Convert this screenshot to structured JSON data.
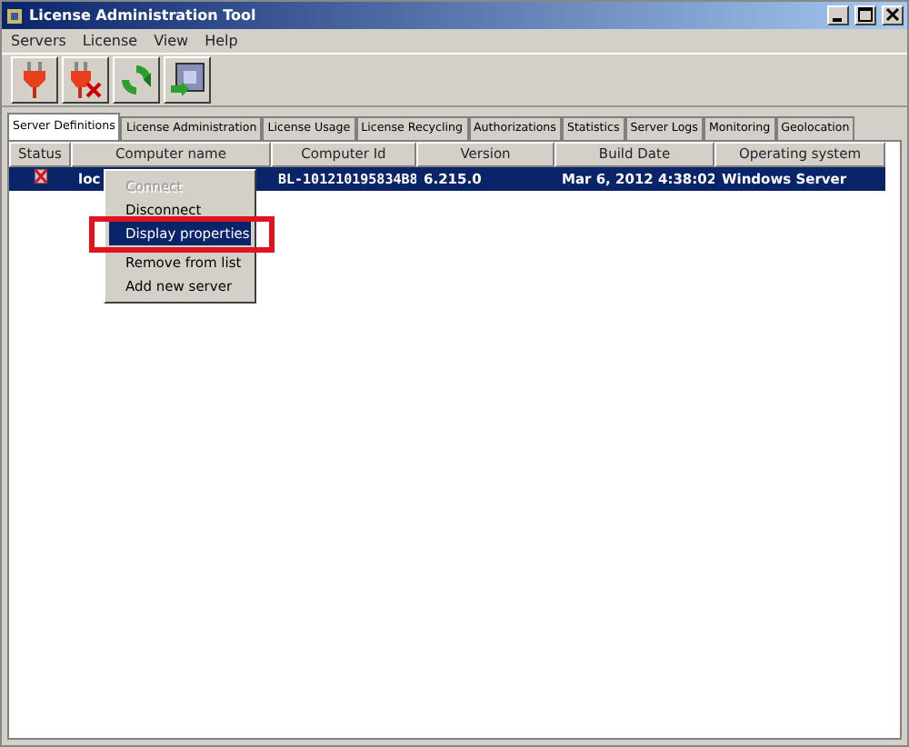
{
  "window": {
    "title": "License Administration Tool"
  },
  "menu_bar": [
    "Servers",
    "License",
    "View",
    "Help"
  ],
  "toolbar": [
    {
      "kind": "plug"
    },
    {
      "kind": "unplug"
    },
    {
      "kind": "refresh"
    },
    {
      "kind": "properties"
    }
  ],
  "tabs": [
    {
      "label": "Server Definitions",
      "selected": true
    },
    {
      "label": "License Administration",
      "selected": false
    },
    {
      "label": "License Usage",
      "selected": false
    },
    {
      "label": "License Recycling",
      "selected": false
    },
    {
      "label": "Authorizations",
      "selected": false
    },
    {
      "label": "Statistics",
      "selected": false
    },
    {
      "label": "Server Logs",
      "selected": false
    },
    {
      "label": "Monitoring",
      "selected": false
    },
    {
      "label": "Geolocation",
      "selected": false
    }
  ],
  "table": {
    "columns": [
      "Status",
      "Computer name",
      "Computer Id",
      "Version",
      "Build Date",
      "Operating system"
    ],
    "rows": [
      {
        "selected": true,
        "cells": [
          "",
          "loc",
          "BL-101210195834B8",
          "6.215.0",
          "Mar 6, 2012 4:38:02",
          "Windows Server"
        ]
      }
    ]
  },
  "context_menu": [
    {
      "label": "Connect",
      "disabled": true,
      "selected": false
    },
    {
      "label": "Disconnect",
      "disabled": false,
      "selected": false
    },
    {
      "label": "Display properties",
      "disabled": false,
      "selected": true,
      "highlighted": true
    },
    {
      "label": "Remove from list",
      "disabled": false,
      "selected": false
    },
    {
      "label": "Add new server",
      "disabled": false,
      "selected": false
    }
  ]
}
